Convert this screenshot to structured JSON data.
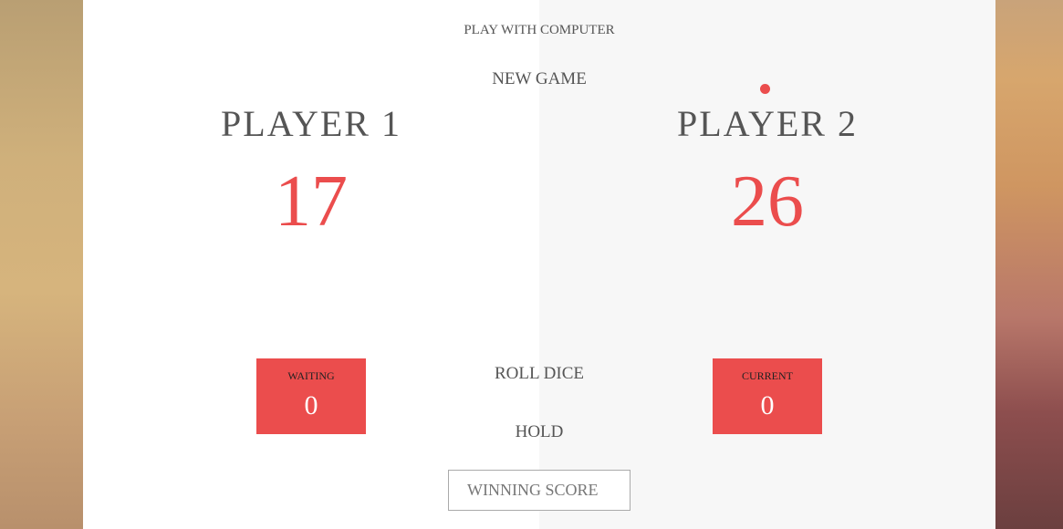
{
  "menu": {
    "play_computer": "PLAY WITH COMPUTER",
    "new_game": "NEW GAME",
    "roll_dice": "ROLL DICE",
    "hold": "HOLD"
  },
  "players": [
    {
      "name": "PLAYER 1",
      "score": "17",
      "current_label": "WAITING",
      "current_value": "0",
      "active": false
    },
    {
      "name": "PLAYER 2",
      "score": "26",
      "current_label": "CURRENT",
      "current_value": "0",
      "active": true
    }
  ],
  "winning_score": {
    "placeholder": "WINNING SCORE",
    "value": ""
  },
  "colors": {
    "accent": "#eb4d4d",
    "text": "#555555",
    "panel_left": "#ffffff",
    "panel_right": "#f7f7f7"
  }
}
